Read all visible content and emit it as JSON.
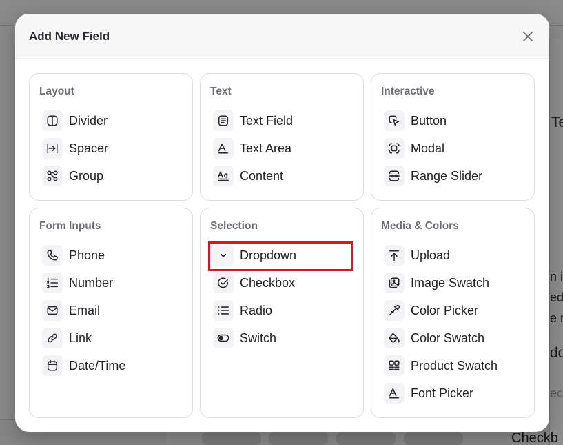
{
  "modal": {
    "title": "Add New Field",
    "close_icon": "close-icon"
  },
  "background": {
    "fragments": [
      "Te",
      "n ip",
      "ed",
      "e m",
      "do",
      "ecti"
    ],
    "bottom_label": "Checkb"
  },
  "highlight_color": "#e0141e",
  "categories": [
    {
      "title": "Layout",
      "items": [
        {
          "label": "Divider",
          "icon": "divider-icon"
        },
        {
          "label": "Spacer",
          "icon": "spacer-icon"
        },
        {
          "label": "Group",
          "icon": "group-icon"
        }
      ]
    },
    {
      "title": "Text",
      "items": [
        {
          "label": "Text Field",
          "icon": "text-field-icon"
        },
        {
          "label": "Text Area",
          "icon": "text-area-icon"
        },
        {
          "label": "Content",
          "icon": "content-icon"
        }
      ]
    },
    {
      "title": "Interactive",
      "items": [
        {
          "label": "Button",
          "icon": "button-cursor-icon"
        },
        {
          "label": "Modal",
          "icon": "modal-icon"
        },
        {
          "label": "Range Slider",
          "icon": "range-slider-icon"
        }
      ]
    },
    {
      "title": "Form Inputs",
      "items": [
        {
          "label": "Phone",
          "icon": "phone-icon"
        },
        {
          "label": "Number",
          "icon": "number-list-icon"
        },
        {
          "label": "Email",
          "icon": "email-icon"
        },
        {
          "label": "Link",
          "icon": "link-icon"
        },
        {
          "label": "Date/Time",
          "icon": "calendar-icon"
        }
      ]
    },
    {
      "title": "Selection",
      "items": [
        {
          "label": "Dropdown",
          "icon": "chevron-down-icon",
          "highlighted": true
        },
        {
          "label": "Checkbox",
          "icon": "check-circle-icon"
        },
        {
          "label": "Radio",
          "icon": "list-icon"
        },
        {
          "label": "Switch",
          "icon": "toggle-icon"
        }
      ]
    },
    {
      "title": "Media & Colors",
      "items": [
        {
          "label": "Upload",
          "icon": "upload-icon"
        },
        {
          "label": "Image Swatch",
          "icon": "image-swatch-icon"
        },
        {
          "label": "Color Picker",
          "icon": "eyedropper-icon"
        },
        {
          "label": "Color Swatch",
          "icon": "paint-bucket-icon"
        },
        {
          "label": "Product Swatch",
          "icon": "product-swatch-icon"
        },
        {
          "label": "Font Picker",
          "icon": "font-picker-icon"
        }
      ]
    }
  ]
}
